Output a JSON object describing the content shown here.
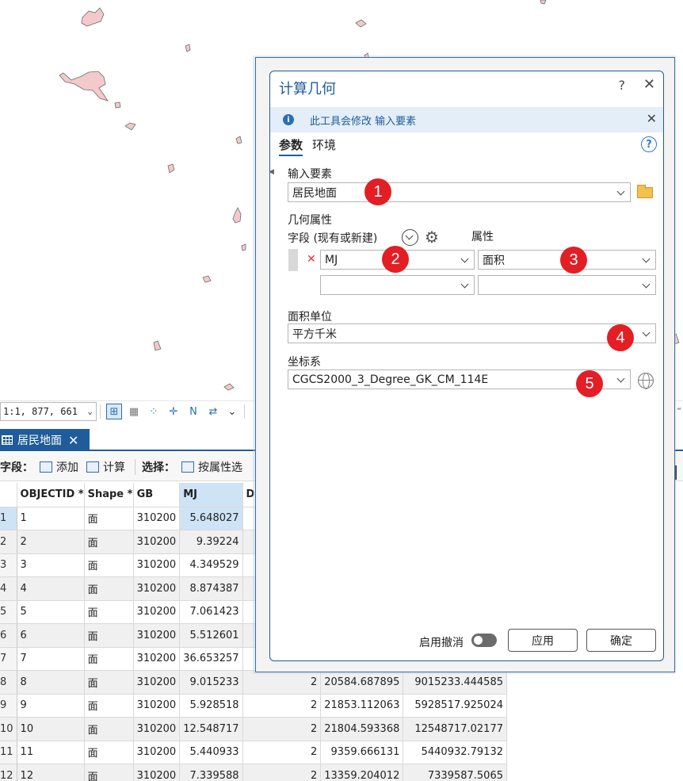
{
  "map_toolbar": {
    "scale": "1:1, 877, 661",
    "right_fragment": "“"
  },
  "table_view": {
    "tab_label": "居民地面",
    "toolbar": {
      "field_label": "字段：",
      "add_label": "添加",
      "calc_label": "计算",
      "select_label": "选择：",
      "select_by_attr_label": "按属性选"
    },
    "columns": [
      "OBJECTID *",
      "Shape *",
      "GB",
      "MJ",
      "D"
    ],
    "rows": [
      {
        "n": "1",
        "oid": "1",
        "shape": "面",
        "gb": "310200",
        "mj": "5.648027",
        "c6": "",
        "c7": "",
        "c8": ""
      },
      {
        "n": "2",
        "oid": "2",
        "shape": "面",
        "gb": "310200",
        "mj": "9.39224",
        "c6": "",
        "c7": "",
        "c8": ""
      },
      {
        "n": "3",
        "oid": "3",
        "shape": "面",
        "gb": "310200",
        "mj": "4.349529",
        "c6": "",
        "c7": "",
        "c8": ""
      },
      {
        "n": "4",
        "oid": "4",
        "shape": "面",
        "gb": "310200",
        "mj": "8.874387",
        "c6": "",
        "c7": "",
        "c8": ""
      },
      {
        "n": "5",
        "oid": "5",
        "shape": "面",
        "gb": "310200",
        "mj": "7.061423",
        "c6": "",
        "c7": "",
        "c8": ""
      },
      {
        "n": "6",
        "oid": "6",
        "shape": "面",
        "gb": "310200",
        "mj": "5.512601",
        "c6": "",
        "c7": "",
        "c8": ""
      },
      {
        "n": "7",
        "oid": "7",
        "shape": "面",
        "gb": "310200",
        "mj": "36.653257",
        "c6": "",
        "c7": "",
        "c8": ""
      },
      {
        "n": "8",
        "oid": "8",
        "shape": "面",
        "gb": "310200",
        "mj": "9.015233",
        "c6": "2",
        "c7": "20584.687895",
        "c8": "9015233.444585"
      },
      {
        "n": "9",
        "oid": "9",
        "shape": "面",
        "gb": "310200",
        "mj": "5.928518",
        "c6": "2",
        "c7": "21853.112063",
        "c8": "5928517.925024"
      },
      {
        "n": "10",
        "oid": "10",
        "shape": "面",
        "gb": "310200",
        "mj": "12.548717",
        "c6": "2",
        "c7": "21804.593368",
        "c8": "12548717.02177"
      },
      {
        "n": "11",
        "oid": "11",
        "shape": "面",
        "gb": "310200",
        "mj": "5.440933",
        "c6": "2",
        "c7": "9359.666131",
        "c8": "5440932.79132"
      },
      {
        "n": "12",
        "oid": "12",
        "shape": "面",
        "gb": "310200",
        "mj": "7.339588",
        "c6": "2",
        "c7": "13359.204012",
        "c8": "7339587.5065"
      }
    ]
  },
  "dialog": {
    "title": "计算几何",
    "help_q": "?",
    "close": "✕",
    "info_text": "此工具会修改 输入要素",
    "info_close": "✕",
    "tabs": {
      "params": "参数",
      "env": "环境"
    },
    "input_features_label": "输入要素",
    "input_features_value": "居民地面",
    "geometry_attrs_label": "几何属性",
    "field_col_label": "字段 (现有或新建)",
    "property_col_label": "属性",
    "row1_field": "MJ",
    "row1_property": "面积",
    "row2_field": "",
    "row2_property": "",
    "area_unit_label": "面积单位",
    "area_unit_value": "平方千米",
    "crs_label": "坐标系",
    "crs_value": "CGCS2000_3_Degree_GK_CM_114E",
    "undo_label": "启用撤消",
    "apply_label": "应用",
    "ok_label": "确定",
    "badges": [
      "1",
      "2",
      "3",
      "4",
      "5"
    ]
  },
  "colors": {
    "accent": "#1f5c99",
    "badge": "#e31e24",
    "polygon_fill": "#f4c9cb"
  }
}
